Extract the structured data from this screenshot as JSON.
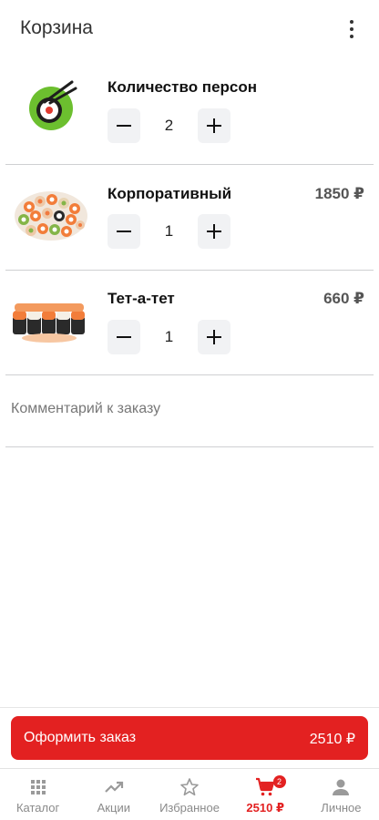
{
  "header": {
    "title": "Корзина",
    "menu_icon": "more-vert-icon"
  },
  "cart": {
    "items": [
      {
        "name": "Количество персон",
        "price": "",
        "quantity": "2",
        "image": "chopsticks-roll-icon"
      },
      {
        "name": "Корпоративный",
        "price": "1850 ₽",
        "quantity": "1",
        "image": "sushi-set-photo"
      },
      {
        "name": "Тет-а-тет",
        "price": "660 ₽",
        "quantity": "1",
        "image": "sushi-rolls-photo"
      }
    ],
    "comment_placeholder": "Комментарий к заказу"
  },
  "checkout": {
    "label": "Оформить заказ",
    "total": "2510 ₽"
  },
  "bottom_nav": {
    "items": [
      {
        "label": "Каталог",
        "icon": "grid-icon"
      },
      {
        "label": "Акции",
        "icon": "trending-up-icon"
      },
      {
        "label": "Избранное",
        "icon": "star-outline-icon"
      },
      {
        "label": "2510 ₽",
        "icon": "cart-icon",
        "badge": "2",
        "active": true
      },
      {
        "label": "Личное",
        "icon": "person-icon"
      }
    ]
  },
  "colors": {
    "accent": "#e32121",
    "stepper_bg": "#f1f2f4",
    "divider": "#cfd0d2",
    "inactive": "#8a8a8a"
  }
}
